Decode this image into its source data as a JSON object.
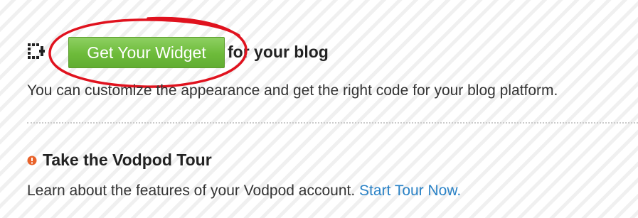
{
  "widget": {
    "icon": "widget-embed-icon",
    "button_label": "Get Your Widget",
    "button_color": "#6dbb3a",
    "suffix": "for your blog",
    "description": "You can customize the appearance and get the right code for your blog platform.",
    "highlight_color": "#e0121e"
  },
  "tour": {
    "bullet_icon": "orange-bullet-icon",
    "bullet_color": "#e8622a",
    "title": "Take the Vodpod Tour",
    "description": "Learn about the features of your Vodpod account.",
    "link_label": "Start Tour Now.",
    "link_color": "#2a82c6"
  }
}
